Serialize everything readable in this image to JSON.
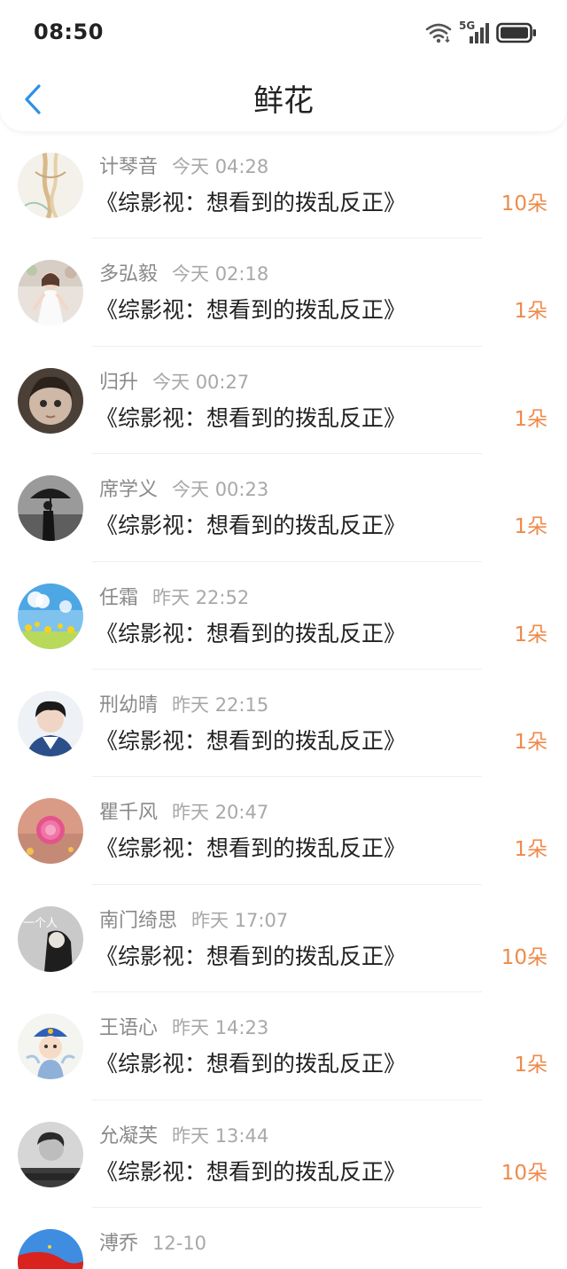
{
  "status_bar": {
    "time": "08:50",
    "network_label": "5G",
    "icons": [
      "wifi-icon",
      "signal-5g-icon",
      "battery-icon"
    ]
  },
  "nav": {
    "title": "鲜花",
    "back_icon": "chevron-left-icon"
  },
  "colors": {
    "accent_blue": "#2f8fe8",
    "count_orange": "#ef8a4a"
  },
  "items": [
    {
      "name": "计琴音",
      "time": "今天 04:28",
      "title": "《综影视：想看到的拨乱反正》",
      "count": "10朵",
      "avatar": "ribbon-illustration-avatar"
    },
    {
      "name": "多弘毅",
      "time": "今天 02:18",
      "title": "《综影视：想看到的拨乱反正》",
      "count": "1朵",
      "avatar": "girl-white-dress-avatar"
    },
    {
      "name": "归升",
      "time": "今天 00:27",
      "title": "《综影视：想看到的拨乱反正》",
      "count": "1朵",
      "avatar": "child-face-avatar"
    },
    {
      "name": "席学义",
      "time": "今天 00:23",
      "title": "《综影视：想看到的拨乱反正》",
      "count": "1朵",
      "avatar": "umbrella-silhouette-avatar"
    },
    {
      "name": "任霜",
      "time": "昨天 22:52",
      "title": "《综影视：想看到的拨乱反正》",
      "count": "1朵",
      "avatar": "sky-flowers-avatar"
    },
    {
      "name": "刑幼晴",
      "time": "昨天 22:15",
      "title": "《综影视：想看到的拨乱反正》",
      "count": "1朵",
      "avatar": "boy-portrait-avatar"
    },
    {
      "name": "瞿千风",
      "time": "昨天 20:47",
      "title": "《综影视：想看到的拨乱反正》",
      "count": "1朵",
      "avatar": "pink-flower-avatar"
    },
    {
      "name": "南门绮思",
      "time": "昨天 17:07",
      "title": "《综影视：想看到的拨乱反正》",
      "count": "10朵",
      "avatar": "gray-girl-avatar",
      "avatar_text": "一个人"
    },
    {
      "name": "王语心",
      "time": "昨天 14:23",
      "title": "《综影视：想看到的拨乱反正》",
      "count": "1朵",
      "avatar": "cartoon-character-avatar"
    },
    {
      "name": "允凝芙",
      "time": "昨天 13:44",
      "title": "《综影视：想看到的拨乱反正》",
      "count": "10朵",
      "avatar": "bw-man-avatar"
    },
    {
      "name": "溥乔",
      "time": "12-10",
      "title": "",
      "count": "",
      "avatar": "flag-avatar"
    }
  ]
}
